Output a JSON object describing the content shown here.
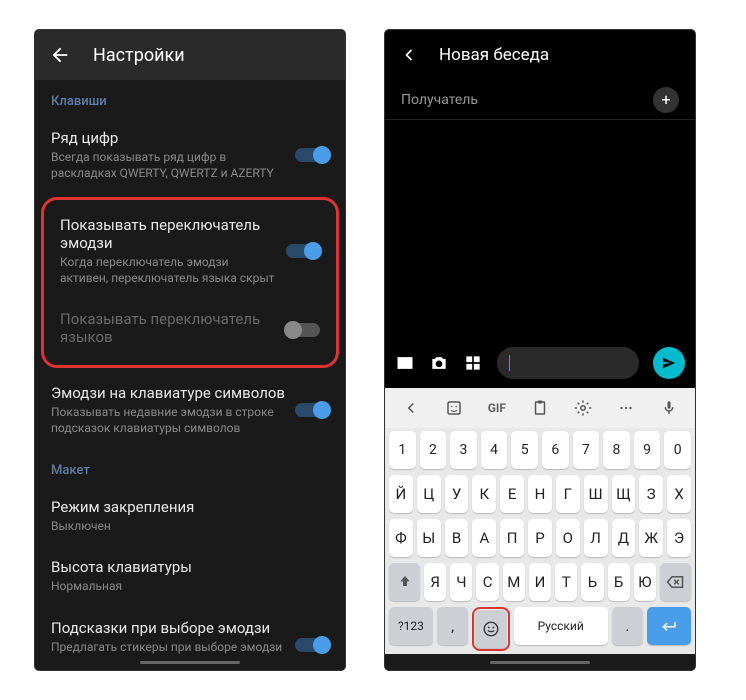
{
  "settings": {
    "title": "Настройки",
    "section_keys": "Клавиши",
    "section_layout": "Макет",
    "items": {
      "digits": {
        "title": "Ряд цифр",
        "sub": "Всегда показывать ряд цифр в раскладках QWERTY, QWERTZ и AZERTY"
      },
      "emoji_switch": {
        "title": "Показывать переключатель эмодзи",
        "sub": "Когда переключатель эмодзи активен, переключатель языка скрыт"
      },
      "lang_switch": {
        "title": "Показывать переключатель языков"
      },
      "emoji_symbols": {
        "title": "Эмодзи на клавиатуре символов",
        "sub": "Показывать недавние эмодзи в строке подсказок клавиатуры символов"
      },
      "pin_mode": {
        "title": "Режим закрепления",
        "sub": "Выключен"
      },
      "height": {
        "title": "Высота клавиатуры",
        "sub": "Нормальная"
      },
      "emoji_hints": {
        "title": "Подсказки при выборе эмодзи",
        "sub": "Предлагать стикеры при выборе эмодзи на клавиатуре"
      }
    }
  },
  "chat": {
    "title": "Новая беседа",
    "recipient": "Получатель",
    "tools": {
      "gif": "GIF"
    },
    "keyboard": {
      "row1": [
        "1",
        "2",
        "3",
        "4",
        "5",
        "6",
        "7",
        "8",
        "9",
        "0"
      ],
      "row2": [
        "Й",
        "Ц",
        "У",
        "К",
        "Е",
        "Н",
        "Г",
        "Ш",
        "Щ",
        "З",
        "Х"
      ],
      "row3": [
        "Ф",
        "Ы",
        "В",
        "А",
        "П",
        "Р",
        "О",
        "Л",
        "Д",
        "Ж",
        "Э"
      ],
      "row4_keys": [
        "Я",
        "Ч",
        "С",
        "М",
        "И",
        "Т",
        "Ь",
        "Б",
        "Ю"
      ],
      "symbols": "?123",
      "comma": ",",
      "space": "Русский",
      "period": "."
    }
  }
}
